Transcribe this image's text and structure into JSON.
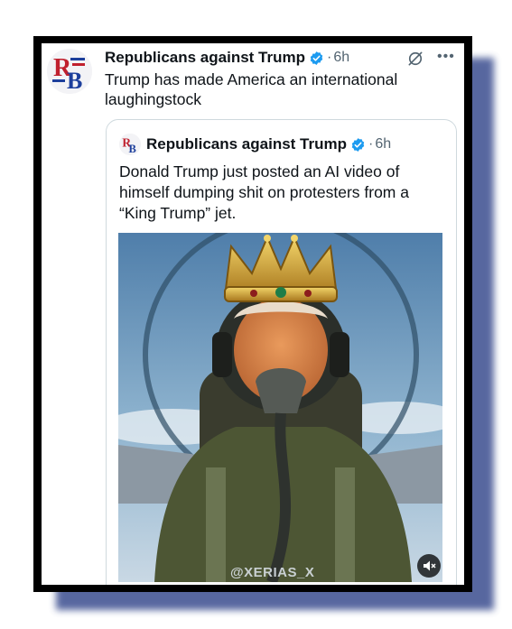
{
  "post": {
    "author": "Republicans against Trump",
    "separator": "·",
    "time": "6h",
    "text": "Trump has made America an international laughingstock",
    "more_icon": "more-options-icon",
    "grok_icon": "grok-icon"
  },
  "quoted": {
    "author": "Republicans against Trump",
    "separator": "·",
    "time": "6h",
    "text": "Donald Trump just posted an AI video of himself dumping shit on protesters from a “King Trump” jet.",
    "media_watermark": "@XERIAS_X",
    "mute_icon": "muted-speaker-icon"
  },
  "logo_letters": "RB",
  "colors": {
    "verified": "#1d9bf0",
    "border": "#cfd9de",
    "muted_text": "#536471",
    "frame_shadow": "#3a4d8f"
  }
}
